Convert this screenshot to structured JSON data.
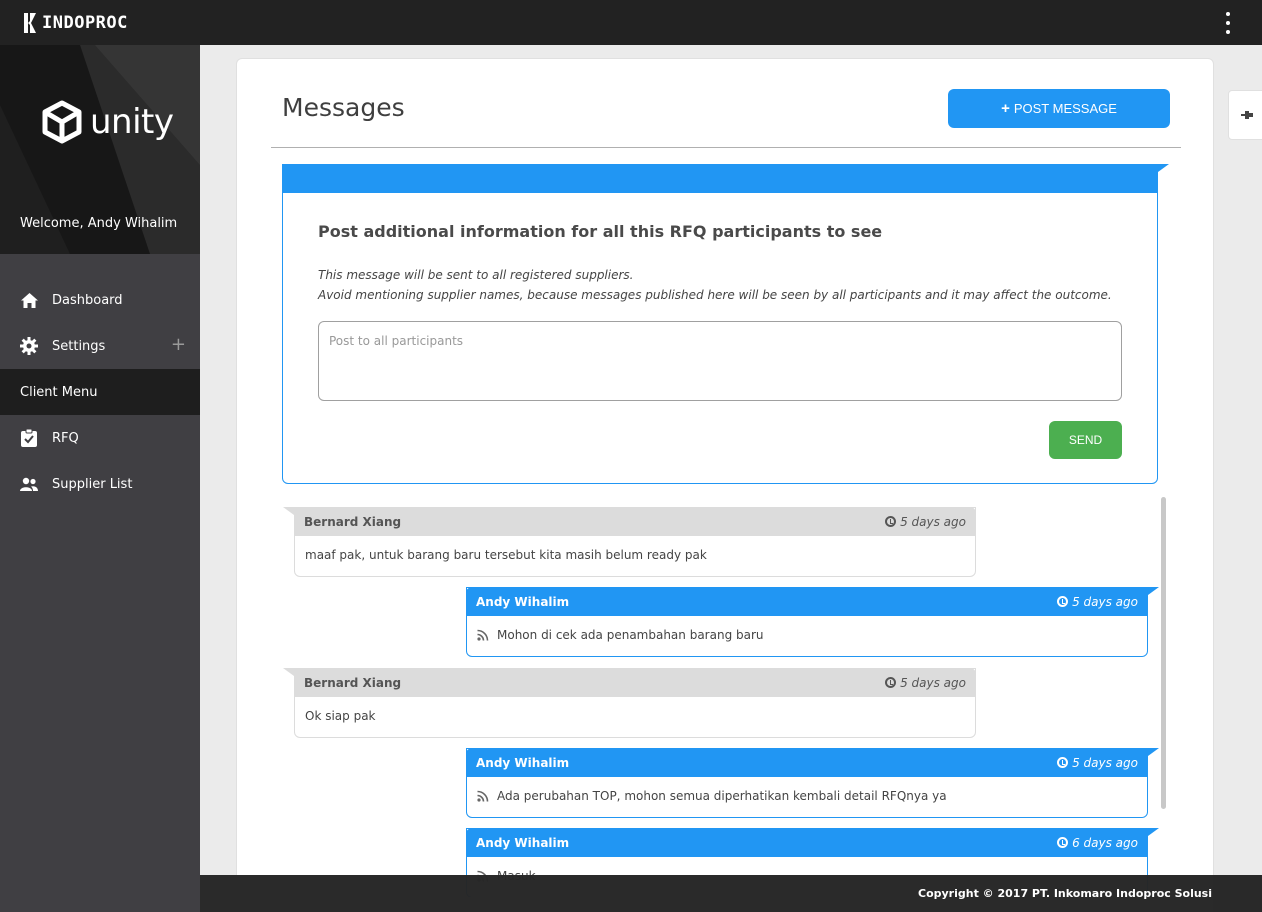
{
  "topbar": {
    "brand_name": "INDOPROC",
    "menu_icon": "kebab-vertical-icon"
  },
  "sidebar": {
    "client_logo_text": "unity",
    "welcome_text": "Welcome, Andy Wihalim",
    "items": [
      {
        "label": "Dashboard",
        "icon": "home-icon"
      },
      {
        "label": "Settings",
        "icon": "gear-icon",
        "expand": "+"
      }
    ],
    "section_label": "Client Menu",
    "client_items": [
      {
        "label": "RFQ",
        "icon": "clipboard-check-icon"
      },
      {
        "label": "Supplier List",
        "icon": "users-icon"
      }
    ]
  },
  "main": {
    "title": "Messages",
    "post_button_label": "POST MESSAGE",
    "post_button_icon": "+",
    "post_box": {
      "title": "Post additional information for all this RFQ participants to see",
      "note_line1": "This message will be sent to all registered suppliers.",
      "note_line2": "Avoid mentioning supplier names, because messages published here will be seen by all participants and it may affect the outcome.",
      "input_placeholder": "Post to all participants",
      "input_value": "",
      "send_label": "SEND"
    },
    "messages": [
      {
        "author": "Bernard Xiang",
        "time": "5 days ago",
        "text": "maaf pak, untuk barang baru tersebut kita masih belum ready pak",
        "direction": "in"
      },
      {
        "author": "Andy Wihalim",
        "time": "5 days ago",
        "text": "Mohon di cek ada penambahan barang baru",
        "direction": "out"
      },
      {
        "author": "Bernard Xiang",
        "time": "5 days ago",
        "text": "Ok siap pak",
        "direction": "in"
      },
      {
        "author": "Andy Wihalim",
        "time": "5 days ago",
        "text": "Ada perubahan TOP, mohon semua diperhatikan kembali detail RFQnya ya",
        "direction": "out"
      },
      {
        "author": "Andy Wihalim",
        "time": "6 days ago",
        "text": "Masuk",
        "direction": "out"
      }
    ]
  },
  "footer": {
    "copyright": "Copyright © 2017 PT. Inkomaro Indoproc Solusi"
  },
  "colors": {
    "topbar": "#222222",
    "sidebar": "#403f43",
    "accent_blue": "#2196f3",
    "send_green": "#4caf50",
    "incoming_header": "#dcdcdc"
  }
}
